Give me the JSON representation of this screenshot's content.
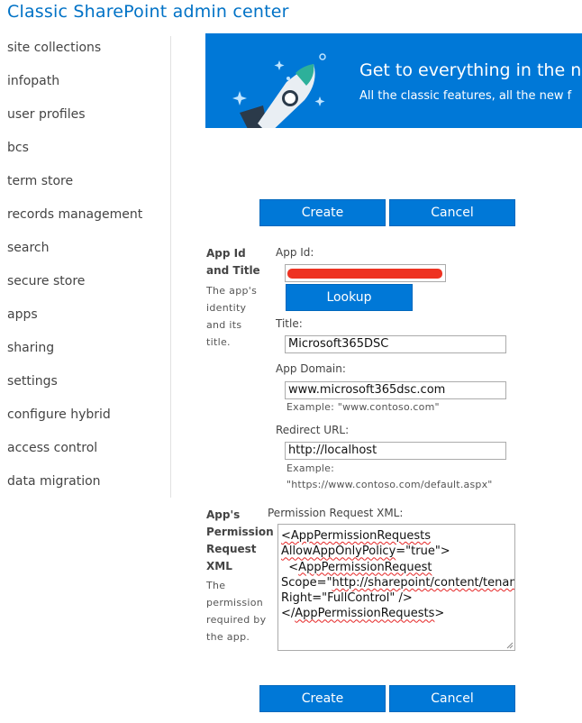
{
  "header": {
    "title": "Classic SharePoint admin center"
  },
  "sidebar": {
    "items": [
      {
        "label": "site collections"
      },
      {
        "label": "infopath"
      },
      {
        "label": "user profiles"
      },
      {
        "label": "bcs"
      },
      {
        "label": "term store"
      },
      {
        "label": "records management"
      },
      {
        "label": "search"
      },
      {
        "label": "secure store"
      },
      {
        "label": "apps"
      },
      {
        "label": "sharing"
      },
      {
        "label": "settings"
      },
      {
        "label": "configure hybrid"
      },
      {
        "label": "access control"
      },
      {
        "label": "data migration"
      }
    ]
  },
  "banner": {
    "heading": "Get to everything in the ne",
    "subtext": "All the classic features, all the new f",
    "icon": "rocket-icon"
  },
  "buttons": {
    "create": "Create",
    "cancel": "Cancel",
    "lookup": "Lookup"
  },
  "sections": {
    "identity": {
      "title": "App Id and Title",
      "description": "The app's identity and its title.",
      "app_id_label": "App Id:",
      "title_label": "Title:",
      "title_value": "Microsoft365DSC",
      "domain_label": "App Domain:",
      "domain_value": "www.microsoft365dsc.com",
      "domain_example": "Example: \"www.contoso.com\"",
      "redirect_label": "Redirect URL:",
      "redirect_value": "http://localhost",
      "redirect_example_1": "Example:",
      "redirect_example_2": "\"https://www.contoso.com/default.aspx\""
    },
    "permission": {
      "title": "App's Permission Request XML",
      "description": "The permission required by the app.",
      "xml_label": "Permission Request XML:",
      "xml": {
        "l1": "<AppPermissionRequests",
        "l2a": "AllowAppOnlyPolicy",
        "l2b": "=\"true\">",
        "l3a": "  <",
        "l3b": "AppPermissionRequest",
        "l4a": "Scope=\"",
        "l4b": "http://sharepoint/content/tenant",
        "l4c": "\"",
        "l5": "Right=\"FullControl\" />",
        "l6a": "</",
        "l6b": "AppPermissionRequests",
        "l6c": ">"
      }
    }
  },
  "colors": {
    "accent": "#0078d7",
    "title": "#0072c6",
    "redaction": "#e32222"
  }
}
